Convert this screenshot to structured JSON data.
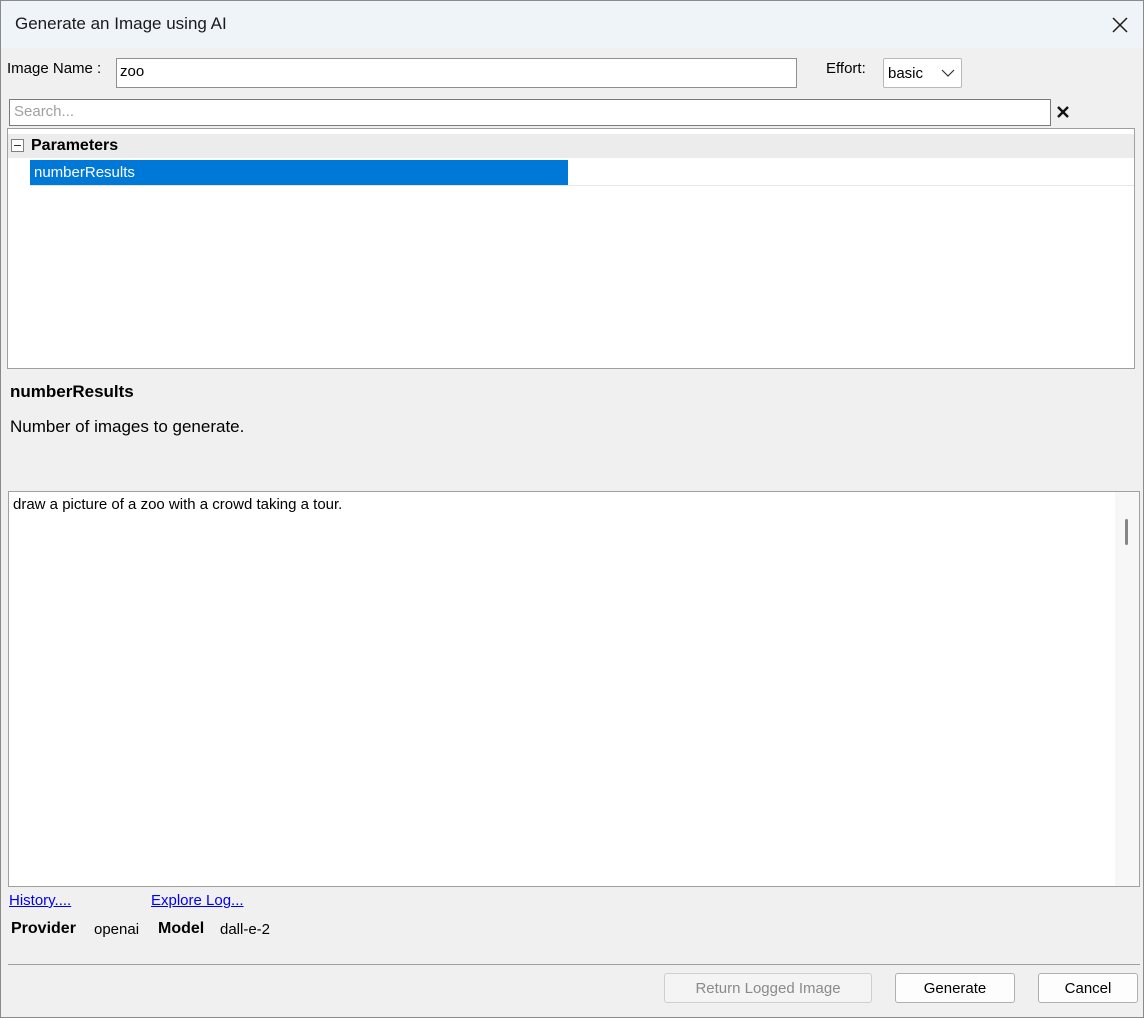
{
  "window": {
    "title": "Generate an Image using AI"
  },
  "form": {
    "image_name_label": "Image Name :",
    "image_name_value": "zoo",
    "effort_label": "Effort:",
    "effort_value": "basic"
  },
  "search": {
    "placeholder": "Search..."
  },
  "tree": {
    "group_label": "Parameters",
    "selected_item": "numberResults"
  },
  "description": {
    "title": "numberResults",
    "text": "Number of images to generate."
  },
  "prompt": {
    "text": "draw a picture of a zoo with a crowd taking a tour."
  },
  "links": {
    "history": "History....",
    "explore_log": "Explore Log..."
  },
  "info": {
    "provider_label": "Provider",
    "provider_value": "openai",
    "model_label": "Model",
    "model_value": "dall-e-2"
  },
  "buttons": {
    "return_logged": "Return Logged Image",
    "generate": "Generate",
    "cancel": "Cancel"
  },
  "colors": {
    "selection": "#0078d7",
    "link": "#0000ee"
  },
  "icons": {
    "close": "close-icon",
    "clear": "clear-search-icon",
    "dropdown": "chevron-down-icon"
  }
}
